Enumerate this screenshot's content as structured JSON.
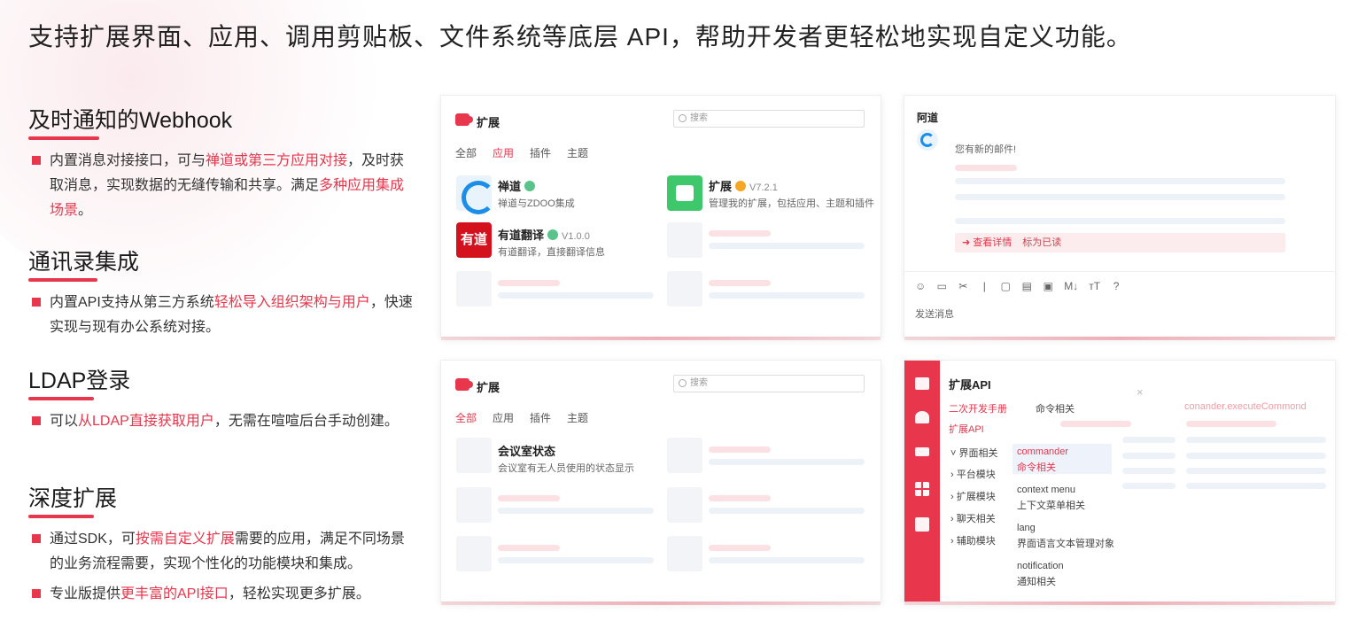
{
  "headline": "支持扩展界面、应用、调用剪贴板、文件系统等底层 API，帮助开发者更轻松地实现自定义功能。",
  "colors": {
    "accent": "#e8364c",
    "green": "#3fc86b",
    "blue": "#1a8ee8"
  },
  "sections": [
    {
      "title": "及时通知的Webhook",
      "bullets": [
        {
          "pre": "内置消息对接接口，可与",
          "hl": "禅道或第三方应用对接",
          "mid": "，及时获取消息，实现数据的无缝传输和共享。满足",
          "hl2": "多种应用集成场景",
          "post": "。"
        }
      ]
    },
    {
      "title": "通讯录集成",
      "bullets": [
        {
          "pre": "内置API支持从第三方系统",
          "hl": "轻松导入组织架构与用户",
          "mid": "，快速实现与现有办公系统对接。",
          "hl2": "",
          "post": ""
        }
      ]
    },
    {
      "title": "LDAP登录",
      "bullets": [
        {
          "pre": "可以",
          "hl": "从LDAP直接获取用户",
          "mid": "，无需在喧喧后台手动创建。",
          "hl2": "",
          "post": ""
        }
      ]
    },
    {
      "title": "深度扩展",
      "bullets": [
        {
          "pre": "通过SDK，可",
          "hl": "按需自定义扩展",
          "mid": "需要的应用，满足不同场景的业务流程需要，实现个性化的功能模块和集成。",
          "hl2": "",
          "post": ""
        },
        {
          "pre": "专业版提供",
          "hl": "更丰富的API接口",
          "mid": "，轻松实现更多扩展。",
          "hl2": "",
          "post": ""
        }
      ]
    }
  ],
  "card1": {
    "title": "扩展",
    "search_placeholder": "搜索",
    "tabs": [
      "全部",
      "应用",
      "插件",
      "主题"
    ],
    "apps": [
      {
        "name": "禅道",
        "version": "",
        "desc": "禅道与ZDOO集成",
        "icon": "zentao-icon"
      },
      {
        "name": "扩展",
        "version": "V7.2.1",
        "desc": "管理我的扩展，包括应用、主题和插件",
        "icon": "puzzle-icon"
      },
      {
        "name": "有道翻译",
        "version": "V1.0.0",
        "desc": "有道翻译，直接翻译信息",
        "icon": "youdao-icon",
        "icon_text": "有道"
      }
    ]
  },
  "card2": {
    "sender": "阿道",
    "message": "您有新的邮件!",
    "action_view": "查看详情",
    "action_read": "标为已读",
    "toolbar": [
      "☺",
      "▭",
      "✂",
      "|",
      "▢",
      "▤",
      "▣",
      "M↓",
      "ᴛT",
      "?"
    ],
    "send_label": "发送消息"
  },
  "card3": {
    "title": "扩展",
    "search_placeholder": "搜索",
    "tabs": [
      "全部",
      "应用",
      "插件",
      "主题"
    ],
    "apps": [
      {
        "name": "会议室状态",
        "desc": "会议室有无人员使用的状态显示"
      }
    ]
  },
  "card4": {
    "title": "扩展API",
    "nav_top": [
      "二次开发手册",
      "扩展API"
    ],
    "cmd_header": "命令相关",
    "tree": [
      "界面相关",
      "平台模块",
      "扩展模块",
      "聊天相关",
      "辅助模块"
    ],
    "commands": [
      {
        "name": "commander",
        "desc": "命令相关"
      },
      {
        "name": "context menu",
        "desc": "上下文菜单相关"
      },
      {
        "name": "lang",
        "desc": "界面语言文本管理对象"
      },
      {
        "name": "notification",
        "desc": "通知相关"
      }
    ],
    "close_glyph": "×",
    "method": "conander.executeCommond"
  }
}
